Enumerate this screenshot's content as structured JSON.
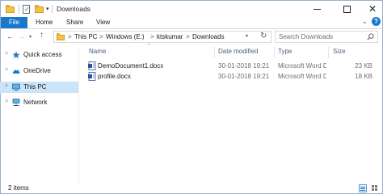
{
  "window": {
    "title": "Downloads",
    "controls": {
      "minimize": "minimize",
      "maximize": "maximize",
      "close": "✕"
    }
  },
  "quick_access_toolbar": {
    "dropdown": "▾"
  },
  "ribbon": {
    "tabs": [
      "File",
      "Home",
      "Share",
      "View"
    ],
    "expand": "⌄",
    "help": "?"
  },
  "navigation": {
    "back": "←",
    "forward": "→",
    "recent": "▾",
    "up": "↑",
    "breadcrumb": [
      "This PC",
      "Windows (E:)",
      "ktskumar",
      "Downloads"
    ],
    "breadcrumb_sep": ">",
    "address_dropdown": "▾",
    "refresh": "↻",
    "search_placeholder": "Search Downloads"
  },
  "sidebar": {
    "items": [
      {
        "label": "Quick access",
        "icon": "star-icon"
      },
      {
        "label": "OneDrive",
        "icon": "cloud-icon"
      },
      {
        "label": "This PC",
        "icon": "computer-icon",
        "selected": true
      },
      {
        "label": "Network",
        "icon": "network-icon"
      }
    ],
    "chevron": ">"
  },
  "file_list": {
    "columns": [
      "Name",
      "Date modified",
      "Type",
      "Size"
    ],
    "sort_indicator": "^",
    "rows": [
      {
        "name": "DemoDocument1.docx",
        "date": "30-01-2018 19:21",
        "type": "Microsoft Word D...",
        "size": "23 KB",
        "icon": "word-document-icon"
      },
      {
        "name": "profile.docx",
        "date": "30-01-2018 19:21",
        "type": "Microsoft Word D...",
        "size": "18 KB",
        "icon": "word-document-icon"
      }
    ]
  },
  "status": {
    "item_count": "2 items"
  },
  "colors": {
    "accent": "#1979ca",
    "selection": "#cce4f7",
    "folder": "#f2c24a",
    "header_text": "#4c607a"
  }
}
